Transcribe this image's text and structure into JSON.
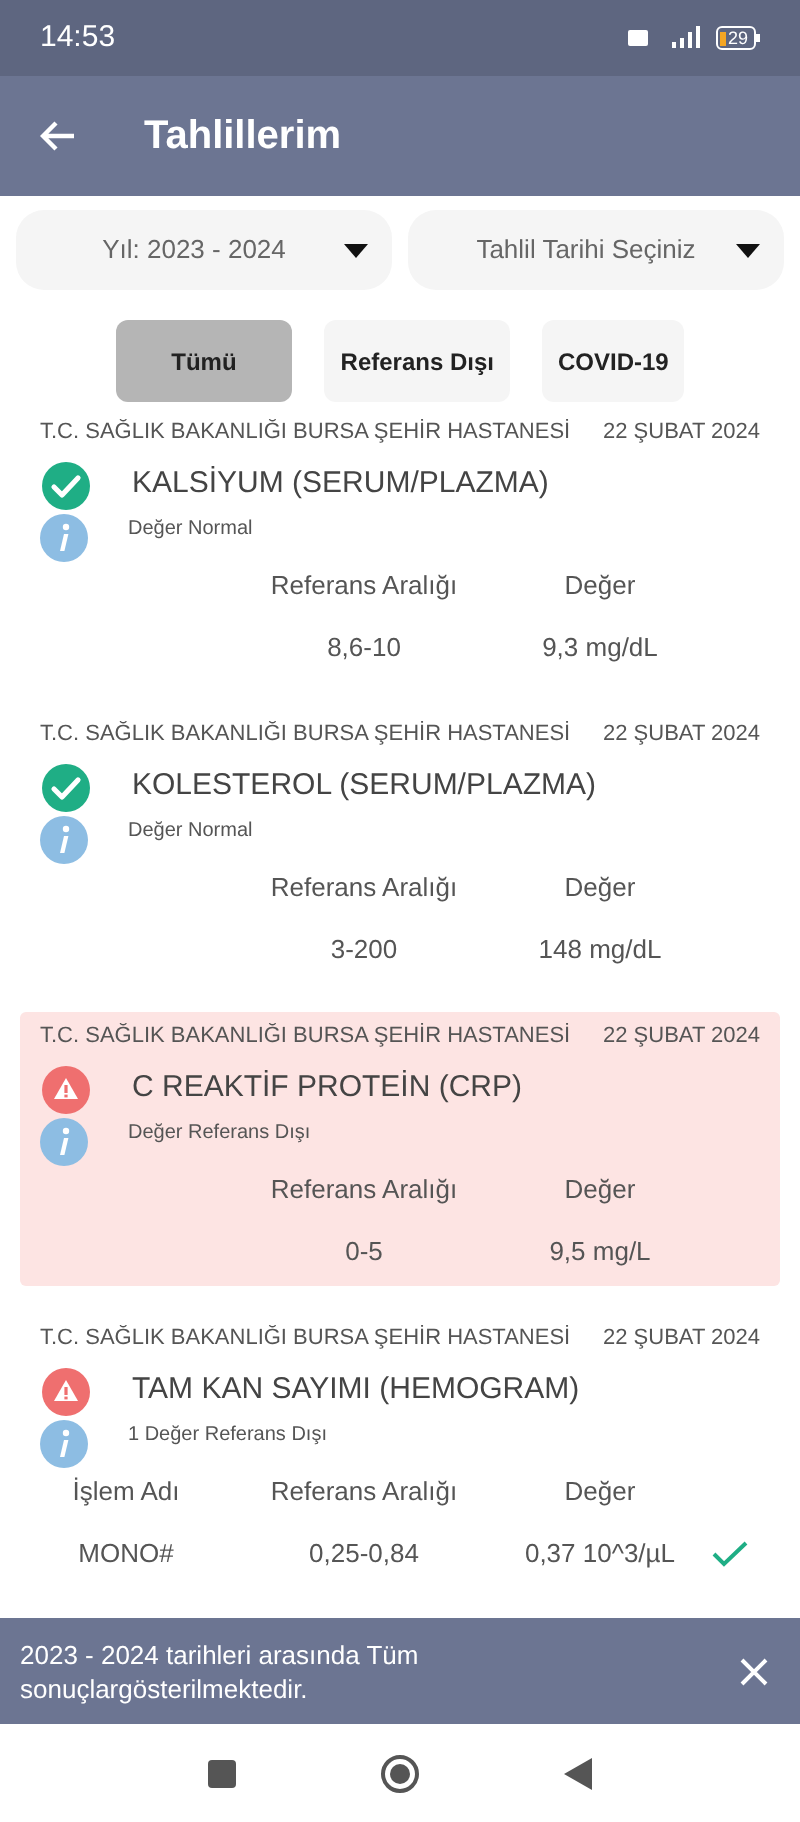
{
  "status_bar": {
    "time": "14:53",
    "battery": "29"
  },
  "header": {
    "title": "Tahlillerim"
  },
  "filters": [
    {
      "value": "Yıl: 2023 - 2024"
    },
    {
      "value": "Tahlil Tarihi Seçiniz"
    }
  ],
  "tabs": [
    {
      "label": "Tümü",
      "selected": true
    },
    {
      "label": "Referans Dışı",
      "selected": false
    },
    {
      "label": "COVID-19",
      "selected": false
    }
  ],
  "results": [
    {
      "hospital": "T.C. SAĞLIK BAKANLIĞI BURSA ŞEHİR HASTANESİ",
      "date": "22 ŞUBAT 2024",
      "test": "KALSİYUM (SERUM/PLAZMA)",
      "kind": "normal",
      "highlighted": false,
      "note": "Değer Normal",
      "columns": [
        "Referans Aralığı",
        "Değer"
      ],
      "rows": [
        {
          "cells": [
            "8,6-10",
            "9,3 mg/dL"
          ]
        }
      ]
    },
    {
      "hospital": "T.C. SAĞLIK BAKANLIĞI BURSA ŞEHİR HASTANESİ",
      "date": "22 ŞUBAT 2024",
      "test": "KOLESTEROL (SERUM/PLAZMA)",
      "kind": "normal",
      "highlighted": false,
      "note": "Değer Normal",
      "columns": [
        "Referans Aralığı",
        "Değer"
      ],
      "rows": [
        {
          "cells": [
            "3-200",
            "148 mg/dL"
          ]
        }
      ]
    },
    {
      "hospital": "T.C. SAĞLIK BAKANLIĞI BURSA ŞEHİR HASTANESİ",
      "date": "22 ŞUBAT 2024",
      "test": "C REAKTİF PROTEİN (CRP)",
      "kind": "out_of_range",
      "highlighted": true,
      "note": "Değer Referans Dışı",
      "columns": [
        "Referans Aralığı",
        "Değer"
      ],
      "rows": [
        {
          "cells": [
            "0-5",
            "9,5 mg/L"
          ]
        }
      ]
    },
    {
      "hospital": "T.C. SAĞLIK BAKANLIĞI BURSA ŞEHİR HASTANESİ",
      "date": "22 ŞUBAT 2024",
      "test": "TAM KAN SAYIMI (HEMOGRAM)",
      "kind": "out_of_range",
      "highlighted": false,
      "note": "1 Değer Referans Dışı",
      "columns": [
        "İşlem Adı",
        "Referans Aralığı",
        "Değer"
      ],
      "rows": [
        {
          "cells": [
            "MONO#",
            "0,25-0,84",
            "0,37 10^3/µL"
          ],
          "in_range": true
        }
      ]
    }
  ],
  "snackbar": {
    "message": "2023 - 2024 tarihleri arasında Tüm sonuçlargösterilmektedir."
  }
}
